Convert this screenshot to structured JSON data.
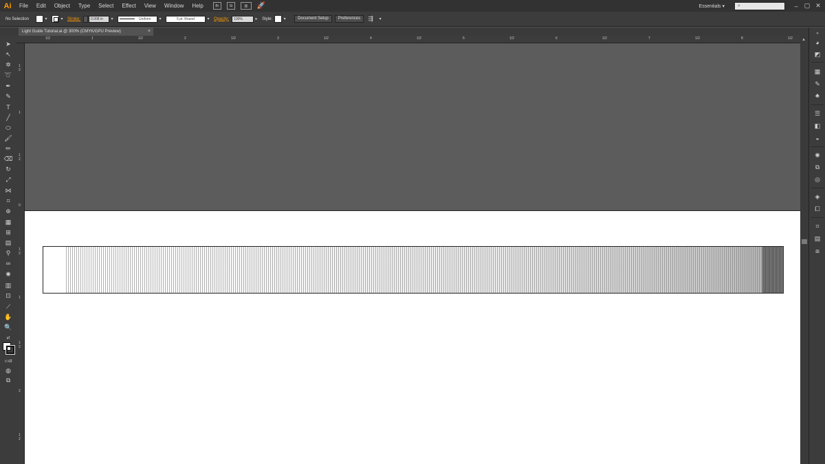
{
  "app": {
    "logo": "Ai"
  },
  "menu": [
    "File",
    "Edit",
    "Object",
    "Type",
    "Select",
    "Effect",
    "View",
    "Window",
    "Help"
  ],
  "menubar": {
    "badges": [
      "Br",
      "St"
    ],
    "workspace": "Essentials ▾",
    "search_placeholder": "",
    "window_controls": [
      "–",
      "▢",
      "✕"
    ]
  },
  "control": {
    "selection": "No Selection",
    "stroke_label": "Stroke:",
    "stroke_value": "0.008 in",
    "profile": "Uniform",
    "brush": "5 pt. Round",
    "opacity_label": "Opacity:",
    "opacity_value": "100%",
    "style_label": "Style:",
    "doc_setup": "Document Setup",
    "preferences": "Preferences"
  },
  "document": {
    "tab_title": "Light Guide Tutorial.ai @ 300% (CMYK/GPU Preview)",
    "close": "×"
  },
  "ruler": {
    "top": [
      "1/2",
      "1",
      "1/2",
      "2",
      "1/2",
      "3",
      "1/2",
      "4",
      "1/2",
      "5",
      "1/2",
      "6",
      "1/2",
      "7",
      "1/2",
      "8",
      "1/2"
    ],
    "left": [
      "1",
      "2",
      "1",
      "1",
      "2",
      "0",
      "1",
      "2",
      "1",
      "1",
      "2",
      "2",
      "1",
      "2"
    ]
  },
  "colors": {
    "accent": "#ff9a00",
    "canvas": "#5c5c5c",
    "artboard": "#ffffff",
    "chrome": "#3c3c3c"
  }
}
